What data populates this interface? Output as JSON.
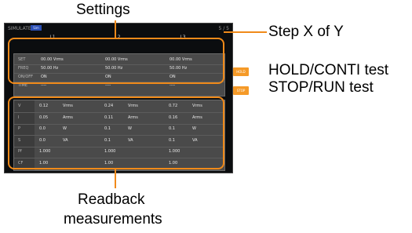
{
  "callouts": {
    "settings": "Settings",
    "step": "Step X of Y",
    "hold": "HOLD/CONTI test",
    "stop": "STOP/RUN test",
    "readback_line1": "Readback",
    "readback_line2": "measurements"
  },
  "screen": {
    "mode": "SIMULATE",
    "badge": "Sim",
    "step": "5 / 5",
    "columns": [
      "L1",
      "L2",
      "L3"
    ]
  },
  "settings_rows": [
    {
      "label": "SET",
      "values": [
        "00.00 Vrms",
        "00.00 Vrms",
        "00.00 Vrms"
      ]
    },
    {
      "label": "FREQ",
      "values": [
        "50.00 Hz",
        "50.00 Hz",
        "50.00 Hz"
      ]
    },
    {
      "label": "ON/OFF",
      "values": [
        "ON",
        "ON",
        "ON"
      ]
    },
    {
      "label": "TIME",
      "values": [
        "----",
        "----",
        "----"
      ]
    }
  ],
  "readback_rows": [
    {
      "label": "V",
      "values": [
        "0.12",
        "0.24",
        "0.72"
      ],
      "unit": "Vrms"
    },
    {
      "label": "I",
      "values": [
        "0.05",
        "0.11",
        "0.16"
      ],
      "unit": "Arms"
    },
    {
      "label": "P",
      "values": [
        "0.0",
        "0.1",
        "0.1"
      ],
      "unit": "W"
    },
    {
      "label": "S",
      "values": [
        "0.0",
        "0.1",
        "0.1"
      ],
      "unit": "VA"
    },
    {
      "label": "Pf",
      "values": [
        "1.000",
        "1.000",
        "1.000"
      ],
      "unit": ""
    },
    {
      "label": "CF",
      "values": [
        "1.00",
        "1.00",
        "1.00"
      ],
      "unit": ""
    }
  ],
  "side_buttons": {
    "hold": "HOLD",
    "stop": "STOP"
  },
  "colors": {
    "annotation": "#f08a1a",
    "screen_bg": "#0b0d0f",
    "panel": "#4a4a4a",
    "button": "#f59a28"
  }
}
